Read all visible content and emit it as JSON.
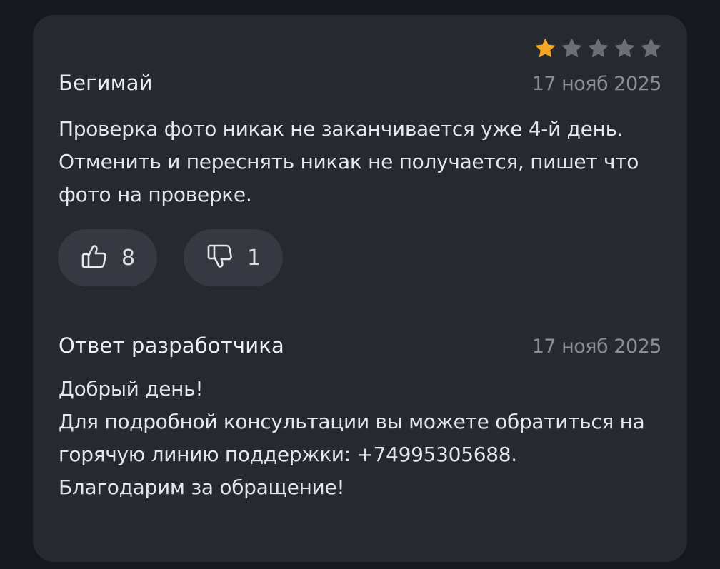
{
  "review": {
    "rating": 1,
    "max_rating": 5,
    "star_active_color": "#f5a524",
    "star_inactive_color": "#6b6e76",
    "author": "Бегимай",
    "date": "17 нояб 2025",
    "text": "Проверка фото никак не заканчивается уже 4-й день. Отменить и переснять никак не получается, пишет что фото на проверке.",
    "likes": {
      "icon": "thumbs-up-icon",
      "count": "8"
    },
    "dislikes": {
      "icon": "thumbs-down-icon",
      "count": "1"
    }
  },
  "developer_reply": {
    "title": "Ответ разработчика",
    "date": "17 нояб 2025",
    "lines": [
      "Добрый день!",
      "Для подробной консультации вы можете обратиться на горячую линию поддержки: +74995305688.",
      "Благодарим за обращение!"
    ]
  }
}
